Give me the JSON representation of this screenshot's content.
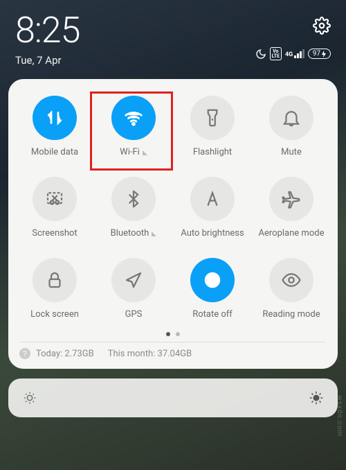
{
  "status": {
    "time": "8:25",
    "date": "Tue, 7 Apr",
    "battery": "97",
    "signal_label": "4G"
  },
  "tiles": {
    "mobile_data": "Mobile data",
    "wifi": "Wi-Fi",
    "flashlight": "Flashlight",
    "mute": "Mute",
    "screenshot": "Screenshot",
    "bluetooth": "Bluetooth",
    "auto_brightness": "Auto brightness",
    "aeroplane": "Aeroplane mode",
    "lock_screen": "Lock screen",
    "gps": "GPS",
    "rotate_off": "Rotate off",
    "reading_mode": "Reading mode"
  },
  "usage": {
    "today_label": "Today:",
    "today_value": "2.73GB",
    "month_label": "This month:",
    "month_value": "37.04GB"
  },
  "watermark": "wsxdn.com"
}
